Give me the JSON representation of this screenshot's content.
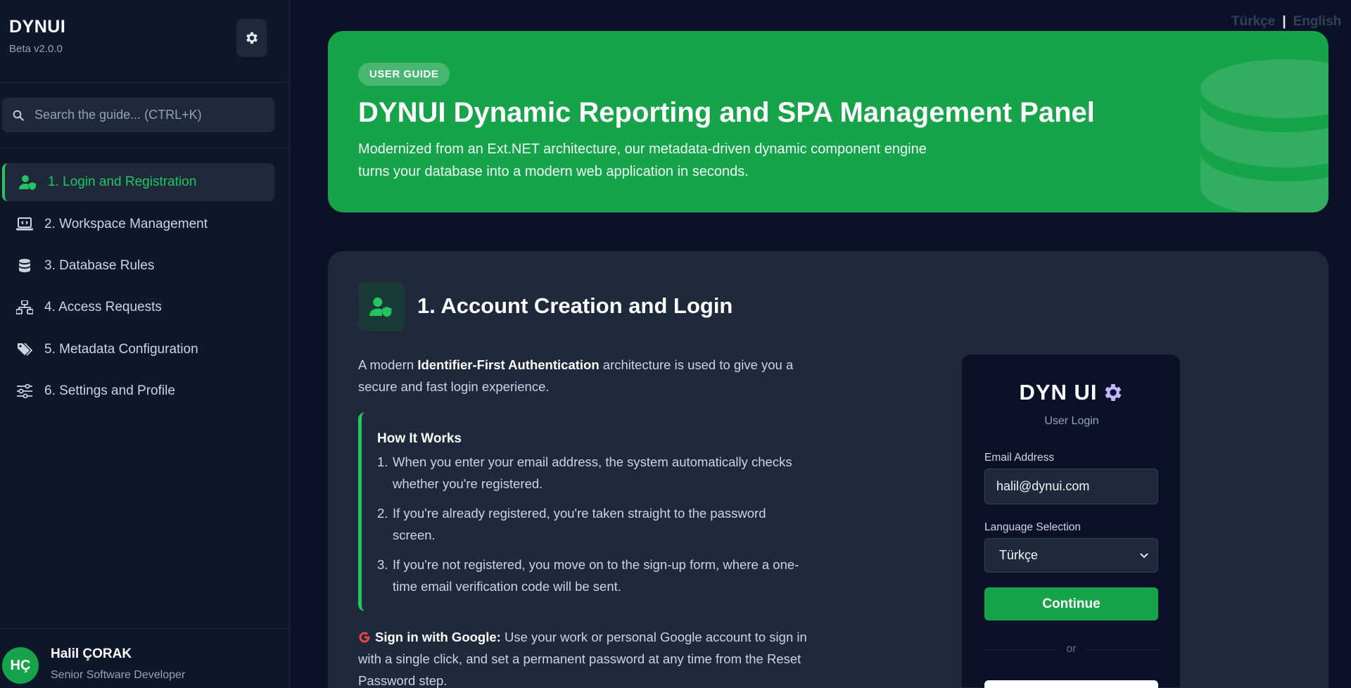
{
  "sidebar": {
    "brand_title": "DYNUI",
    "brand_version": "Beta v2.0.0",
    "theme_toggle_icon": "gear-icon",
    "search_placeholder": "Search the guide... (CTRL+K)",
    "items": [
      {
        "label": "1. Login and Registration",
        "icon": "user-shield-icon",
        "active": true
      },
      {
        "label": "2. Workspace Management",
        "icon": "laptop-code-icon",
        "active": false
      },
      {
        "label": "3. Database Rules",
        "icon": "database-icon",
        "active": false
      },
      {
        "label": "4. Access Requests",
        "icon": "sitemap-icon",
        "active": false
      },
      {
        "label": "5. Metadata Configuration",
        "icon": "tags-icon",
        "active": false
      },
      {
        "label": "6. Settings and Profile",
        "icon": "sliders-icon",
        "active": false
      }
    ],
    "user": {
      "initials": "HÇ",
      "name": "Halil ÇORAK",
      "role": "Senior Software Developer"
    }
  },
  "lang": {
    "tr": "Türkçe",
    "sep": "|",
    "en": "English"
  },
  "hero": {
    "badge": "USER GUIDE",
    "title": "DYNUI Dynamic Reporting and SPA Management Panel",
    "desc_line1": "Modernized from an Ext.NET architecture, our metadata-driven dynamic component engine",
    "desc_line2": "turns your database into a modern web application in seconds."
  },
  "section": {
    "title": "1. Account Creation and Login",
    "intro_pre": "A modern ",
    "intro_bold": "Identifier-First Authentication",
    "intro_post": " architecture is used to give you a secure and fast login experience.",
    "how_title": "How It Works",
    "how_steps": [
      {
        "num": "1.",
        "text": "When you enter your email address, the system automatically checks whether you're registered."
      },
      {
        "num": "2.",
        "text": "If you're already registered, you're taken straight to the password screen."
      },
      {
        "num": "3.",
        "text": "If you're not registered, you move on to the sign-up form, where a one-time email verification code will be sent."
      }
    ],
    "google_bold": "Sign in with Google:",
    "google_text": " Use your work or personal Google account to sign in with a single click, and set a permanent password at any time from the Reset Password step."
  },
  "login_mock": {
    "title": "DYN UI",
    "subtitle": "User Login",
    "email_label": "Email Address",
    "email_value": "halil@dynui.com",
    "lang_label": "Language Selection",
    "lang_value": "Türkçe",
    "continue_label": "Continue",
    "or_label": "or"
  },
  "colors": {
    "accent": "#16a34a",
    "accent_light": "#22c55e",
    "bg": "#0b1227",
    "card": "#1e293b"
  }
}
